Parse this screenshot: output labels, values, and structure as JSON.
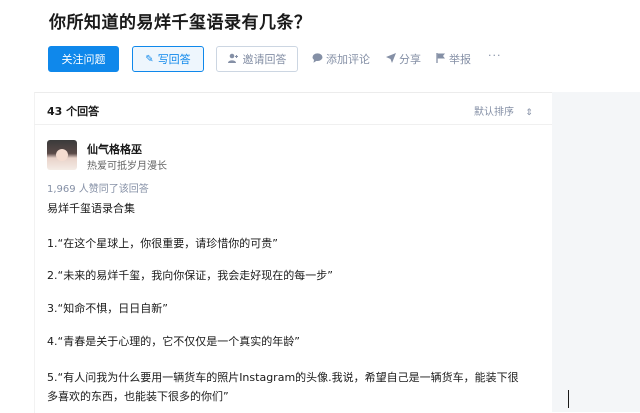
{
  "question": {
    "title": "你所知道的易烊千玺语录有几条？"
  },
  "actions": {
    "follow": "关注问题",
    "write": "写回答",
    "invite": "邀请回答",
    "comment": "添加评论",
    "share": "分享",
    "report": "举报",
    "more": "···"
  },
  "answers": {
    "count": "43 个回答",
    "sort": "默认排序",
    "sort_icon": "⇕"
  },
  "answer": {
    "author": {
      "name": "仙气格格巫",
      "bio": "热爱可抵岁月漫长"
    },
    "votes": "1,969 人赞同了该回答",
    "lines": [
      "易烊千玺语录合集",
      "1.“在这个星球上，你很重要，请珍惜你的可贵”",
      "2.“未来的易烊千玺，我向你保证，我会走好现在的每一步”",
      "3.“知命不惧，日日自新”",
      "4.“青春是关于心理的，它不仅仅是一个真实的年龄”",
      "5.“有人问我为什么要用一辆货车的照片Instagram的头像.我说，希望自己是一辆货车，能装下很",
      "多喜欢的东西，也能装下很多的你们”"
    ]
  },
  "icons": {
    "write": "pencil-icon",
    "invite": "add-user-icon",
    "comment": "comment-bubble-icon",
    "share": "paper-plane-icon",
    "report": "flag-icon"
  },
  "colors": {
    "primary": "#0f88eb",
    "muted": "#8590a6"
  }
}
